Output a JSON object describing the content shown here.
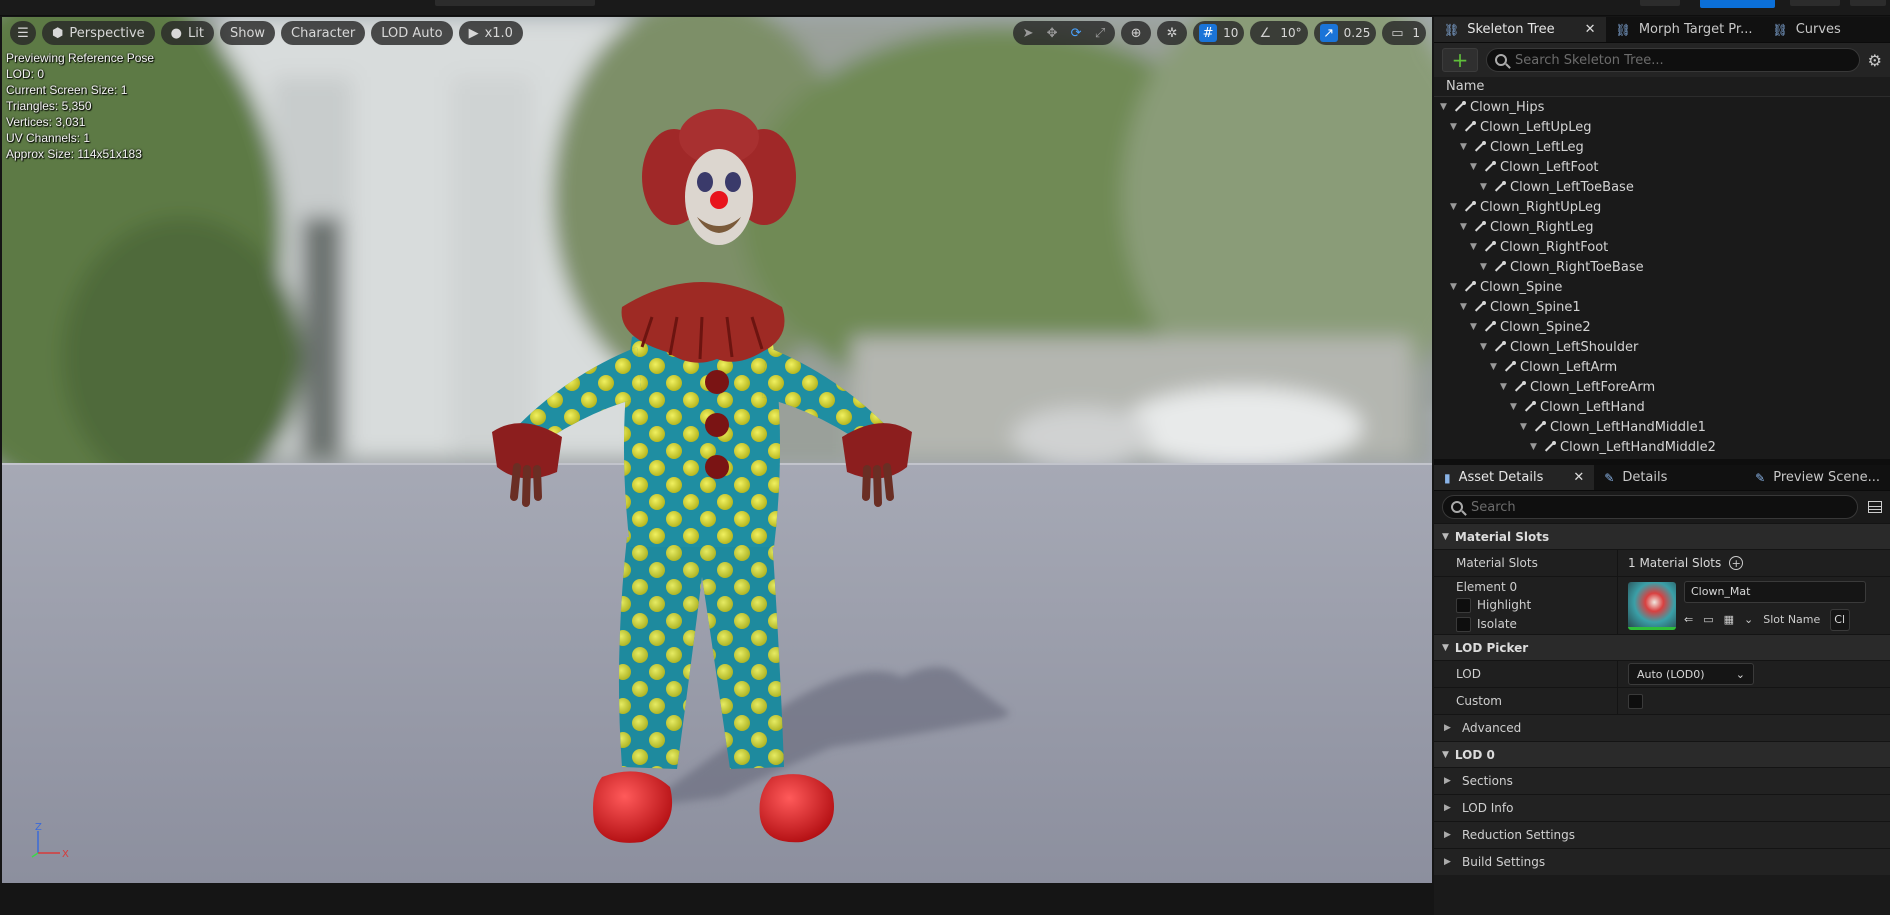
{
  "viewport": {
    "mode": "Perspective",
    "lighting": "Lit",
    "show": "Show",
    "character": "Character",
    "lod": "LOD Auto",
    "speed": "x1.0",
    "grid_value": "10",
    "angle_value": "10°",
    "scale_value": "0.25",
    "camera_speed": "1",
    "stats": [
      "Previewing Reference Pose",
      "LOD: 0",
      "Current Screen Size: 1",
      "Triangles: 5,350",
      "Vertices: 3,031",
      "UV Channels: 1",
      "Approx Size: 114x51x183"
    ],
    "axis": {
      "z": "Z",
      "x": "X"
    }
  },
  "skeleton_panel": {
    "tabs": [
      {
        "label": "Skeleton Tree",
        "active": true
      },
      {
        "label": "Morph Target Pr...",
        "active": false
      },
      {
        "label": "Curves",
        "active": false
      }
    ],
    "search_placeholder": "Search Skeleton Tree...",
    "column_header": "Name",
    "bones": [
      {
        "name": "Clown_Hips",
        "depth": 0
      },
      {
        "name": "Clown_LeftUpLeg",
        "depth": 1
      },
      {
        "name": "Clown_LeftLeg",
        "depth": 2
      },
      {
        "name": "Clown_LeftFoot",
        "depth": 3
      },
      {
        "name": "Clown_LeftToeBase",
        "depth": 4
      },
      {
        "name": "Clown_RightUpLeg",
        "depth": 1
      },
      {
        "name": "Clown_RightLeg",
        "depth": 2
      },
      {
        "name": "Clown_RightFoot",
        "depth": 3
      },
      {
        "name": "Clown_RightToeBase",
        "depth": 4
      },
      {
        "name": "Clown_Spine",
        "depth": 1
      },
      {
        "name": "Clown_Spine1",
        "depth": 2
      },
      {
        "name": "Clown_Spine2",
        "depth": 3
      },
      {
        "name": "Clown_LeftShoulder",
        "depth": 4
      },
      {
        "name": "Clown_LeftArm",
        "depth": 5
      },
      {
        "name": "Clown_LeftForeArm",
        "depth": 6
      },
      {
        "name": "Clown_LeftHand",
        "depth": 7
      },
      {
        "name": "Clown_LeftHandMiddle1",
        "depth": 8
      },
      {
        "name": "Clown_LeftHandMiddle2",
        "depth": 9
      }
    ]
  },
  "details_panel": {
    "tabs": [
      {
        "label": "Asset Details",
        "active": true
      },
      {
        "label": "Details",
        "active": false
      },
      {
        "label": "Preview Scene...",
        "active": false
      }
    ],
    "search_placeholder": "Search",
    "material_slots_section": "Material Slots",
    "material_slots_label": "Material Slots",
    "material_slots_value": "1 Material Slots",
    "element_label": "Element 0",
    "highlight_label": "Highlight",
    "isolate_label": "Isolate",
    "material_name": "Clown_Mat",
    "slot_name_label": "Slot Name",
    "slot_name_value": "Cl",
    "lod_picker_section": "LOD Picker",
    "lod_label": "LOD",
    "lod_value": "Auto (LOD0)",
    "custom_label": "Custom",
    "advanced_label": "Advanced",
    "lod0_section": "LOD 0",
    "sections_label": "Sections",
    "lod_info_label": "LOD Info",
    "reduction_label": "Reduction Settings",
    "build_label": "Build Settings"
  }
}
